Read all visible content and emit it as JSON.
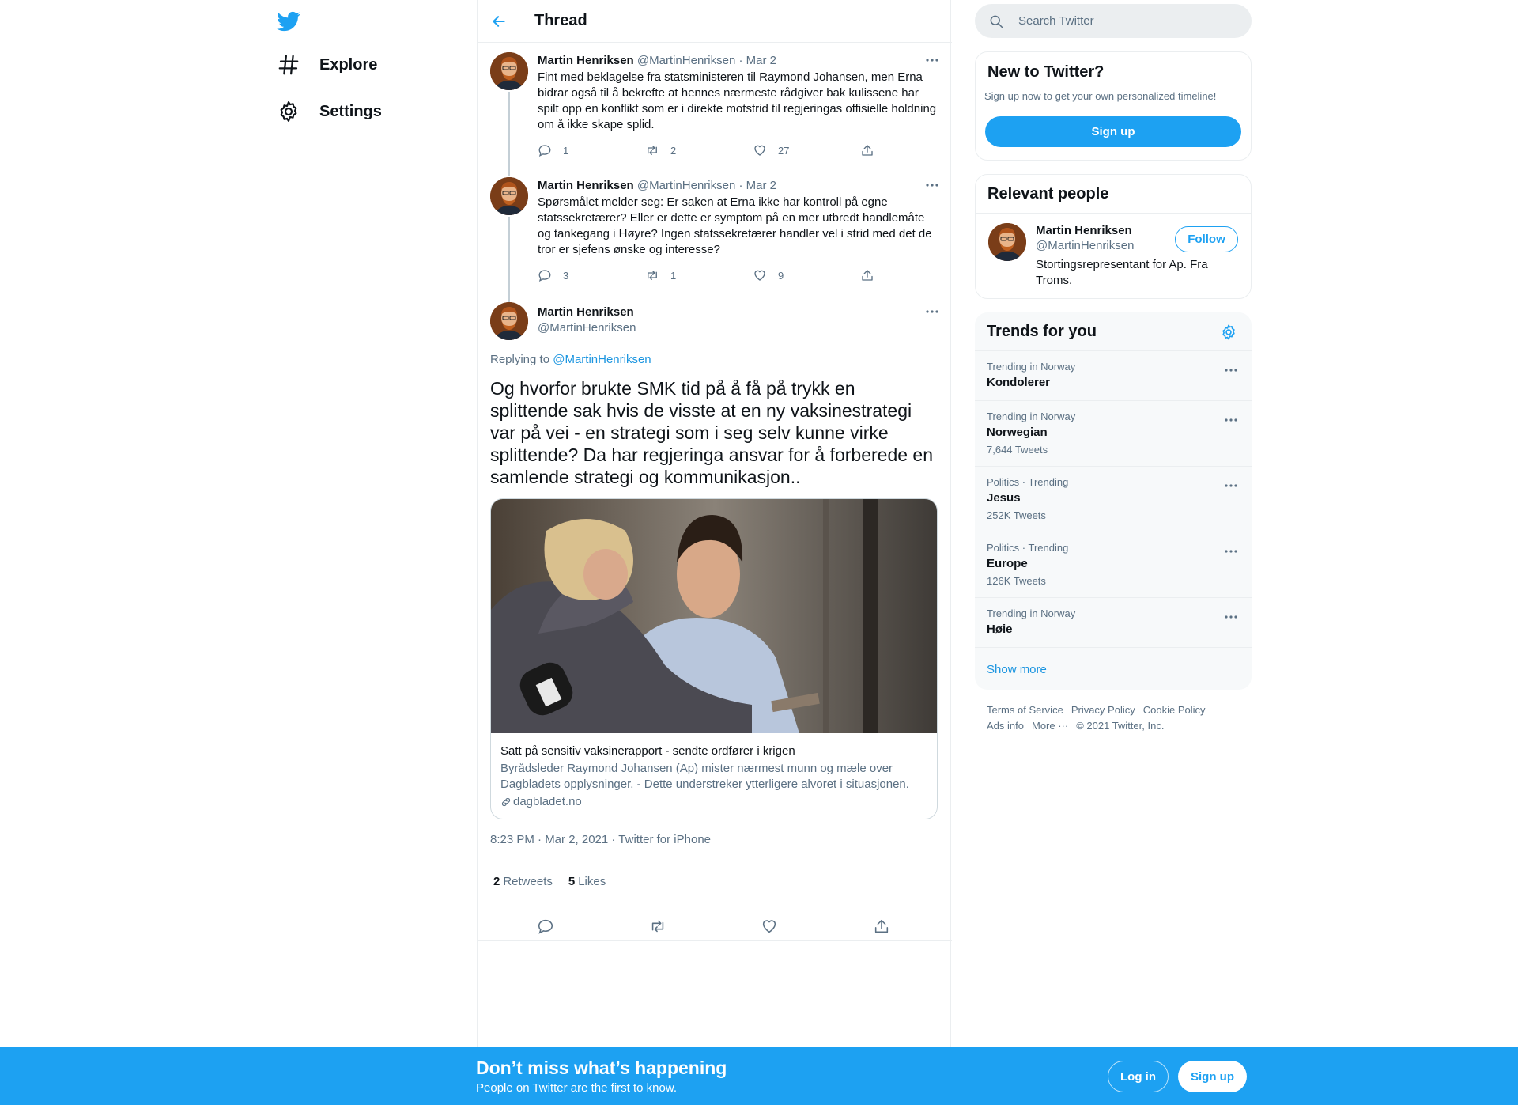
{
  "colors": {
    "accent": "#1da1f2",
    "link": "#1b95e0",
    "secondary_text": "#5b7083",
    "border": "#ebeef0"
  },
  "nav": {
    "logo_icon": "twitter-bird-icon",
    "items": [
      {
        "label": "Explore",
        "icon": "hashtag-icon"
      },
      {
        "label": "Settings",
        "icon": "gear-icon"
      }
    ]
  },
  "header": {
    "title": "Thread",
    "back_icon": "arrow-left-icon"
  },
  "thread": [
    {
      "name": "Martin Henriksen",
      "handle": "@MartinHenriksen",
      "date": "Mar 2",
      "text": "Fint med beklagelse fra statsministeren til Raymond Johansen, men Erna bidrar også til å bekrefte at hennes nærmeste rådgiver bak kulissene har spilt opp en konflikt som er i direkte motstrid til regjeringas offisielle holdning om å ikke skape splid.",
      "replies": "1",
      "retweets": "2",
      "likes": "27"
    },
    {
      "name": "Martin Henriksen",
      "handle": "@MartinHenriksen",
      "date": "Mar 2",
      "text": "Spørsmålet melder seg: Er saken at Erna ikke har kontroll på egne statssekretærer? Eller er dette er symptom på en mer utbredt handlemåte og tankegang i Høyre? Ingen statssekretærer handler vel i strid med det de tror er sjefens ønske og interesse?",
      "replies": "3",
      "retweets": "1",
      "likes": "9"
    }
  ],
  "main_tweet": {
    "name": "Martin Henriksen",
    "handle": "@MartinHenriksen",
    "replying_prefix": "Replying to",
    "replying_to": "@MartinHenriksen",
    "text": "Og hvorfor brukte SMK tid på å få på trykk en splittende sak hvis de visste at en ny vaksinestrategi var på vei - en strategi som i seg selv kunne virke splittende? Da har regjeringa ansvar for å forberede en samlende strategi og kommunikasjon..",
    "card": {
      "title": "Satt på sensitiv vaksinerapport - sendte ordfører i krigen",
      "description": "Byrådsleder Raymond Johansen (Ap) mister nærmest munn og mæle over Dagbladets opplysninger. - Dette understreker ytterligere alvoret i situasjonen.",
      "domain": "dagbladet.no"
    },
    "meta": "8:23 PM · Mar 2, 2021 · Twitter for iPhone",
    "retweets_count": "2",
    "retweets_label": "Retweets",
    "likes_count": "5",
    "likes_label": "Likes"
  },
  "search": {
    "placeholder": "Search Twitter"
  },
  "new_to_twitter": {
    "title": "New to Twitter?",
    "subtitle": "Sign up now to get your own personalized timeline!",
    "button": "Sign up"
  },
  "relevant_people": {
    "title": "Relevant people",
    "person": {
      "name": "Martin Henriksen",
      "handle": "@MartinHenriksen",
      "bio": "Stortingsrepresentant for Ap. Fra Troms.",
      "follow": "Follow"
    }
  },
  "trends": {
    "title": "Trends for you",
    "items": [
      {
        "context": "Trending in Norway",
        "name": "Kondolerer",
        "count": ""
      },
      {
        "context": "Trending in Norway",
        "name": "Norwegian",
        "count": "7,644 Tweets"
      },
      {
        "context": "Politics · Trending",
        "name": "Jesus",
        "count": "252K Tweets"
      },
      {
        "context": "Politics · Trending",
        "name": "Europe",
        "count": "126K Tweets"
      },
      {
        "context": "Trending in Norway",
        "name": "Høie",
        "count": ""
      }
    ],
    "show_more": "Show more"
  },
  "footer": {
    "links": [
      "Terms of Service",
      "Privacy Policy",
      "Cookie Policy",
      "Ads info",
      "More ···"
    ],
    "copyright": "© 2021 Twitter, Inc."
  },
  "bottom_bar": {
    "title": "Don’t miss what’s happening",
    "subtitle": "People on Twitter are the first to know.",
    "login": "Log in",
    "signup": "Sign up"
  }
}
